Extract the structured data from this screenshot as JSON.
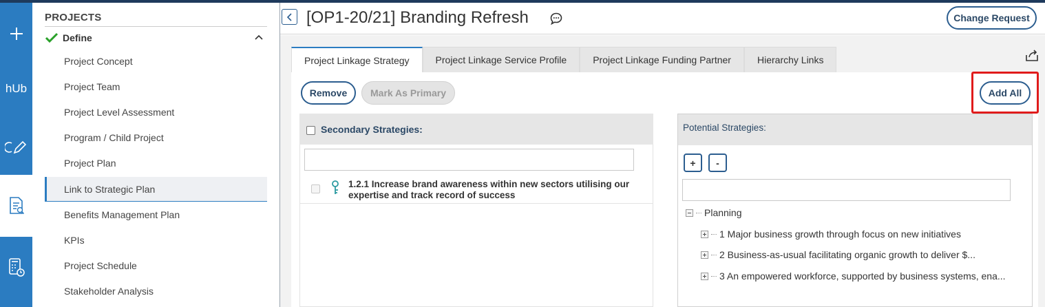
{
  "rail": {
    "items": [
      {
        "name": "add-icon"
      },
      {
        "name": "hub-logo",
        "text": "hUb"
      },
      {
        "name": "pencil-icon"
      },
      {
        "name": "document-search-icon"
      },
      {
        "name": "calculator-clock-icon"
      }
    ]
  },
  "nav": {
    "title": "PROJECTS",
    "section": "Define",
    "items": [
      "Project Concept",
      "Project Team",
      "Project Level Assessment",
      "Program / Child Project",
      "Project Plan",
      "Link to Strategic Plan",
      "Benefits Management Plan",
      "KPIs",
      "Project Schedule",
      "Stakeholder Analysis"
    ],
    "active_index": 5
  },
  "header": {
    "title": "[OP1-20/21] Branding Refresh",
    "change_request": "Change Request"
  },
  "tabs": [
    "Project Linkage Strategy",
    "Project Linkage Service Profile",
    "Project Linkage Funding Partner",
    "Hierarchy Links"
  ],
  "actions": {
    "remove": "Remove",
    "mark_primary": "Mark As Primary",
    "add_all": "Add All"
  },
  "secondary": {
    "heading": "Secondary Strategies:",
    "filter_value": "",
    "rows": [
      {
        "text": "1.2.1 Increase brand awareness within new sectors utilising our expertise and track record of success"
      }
    ]
  },
  "potential": {
    "heading": "Potential Strategies:",
    "expand_label": "+",
    "collapse_label": "-",
    "filter_value": "",
    "root": "Planning",
    "children": [
      "1 Major business growth through focus on new initiatives",
      "2 Business-as-usual facilitating organic growth to deliver $...",
      "3 An empowered workforce, supported by business systems, ena..."
    ]
  },
  "colors": {
    "accent": "#2b7cc1",
    "button_border": "#2b5d8f",
    "highlight": "#e01b1b",
    "check": "#2aa12a",
    "key_icon": "#2b9aa0"
  }
}
